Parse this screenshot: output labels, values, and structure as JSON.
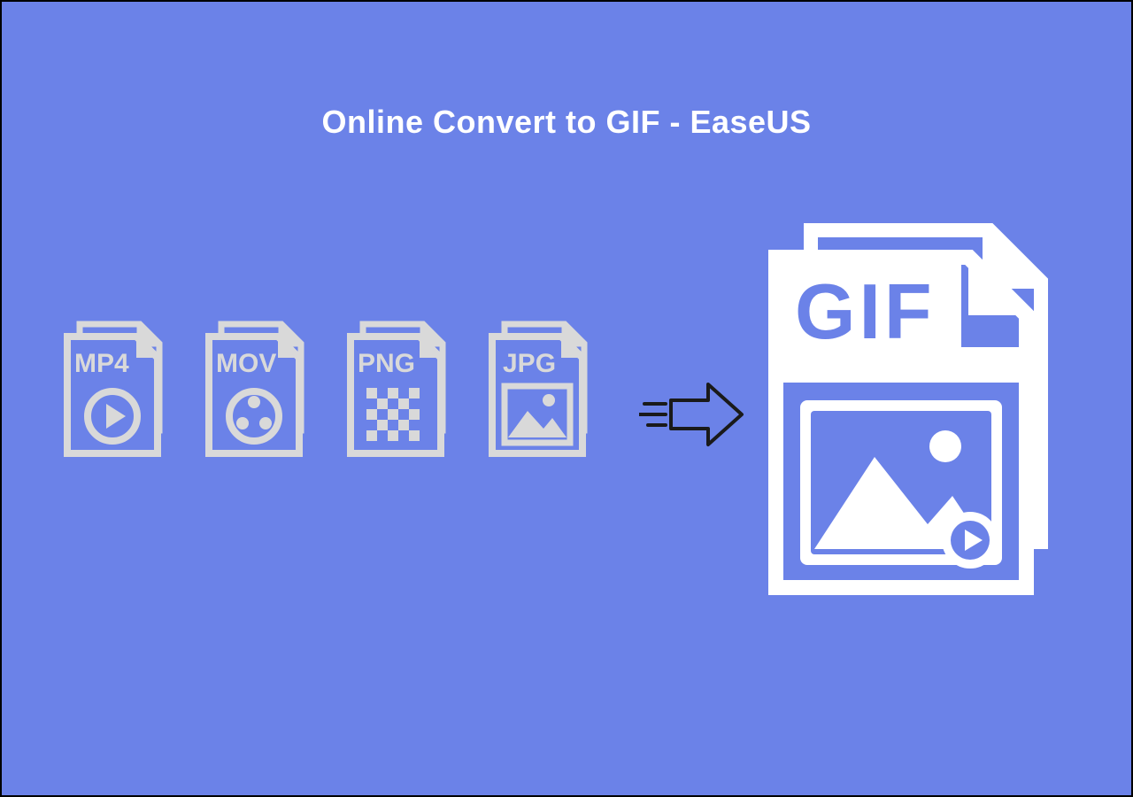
{
  "title": "Online Convert to GIF - EaseUS",
  "source_formats": [
    "MP4",
    "MOV",
    "PNG",
    "JPG"
  ],
  "target_format": "GIF",
  "colors": {
    "bg": "#6b82e8",
    "icon_muted": "#d9d9d9",
    "icon_bright": "#ffffff",
    "arrow": "#1a1a1a"
  }
}
